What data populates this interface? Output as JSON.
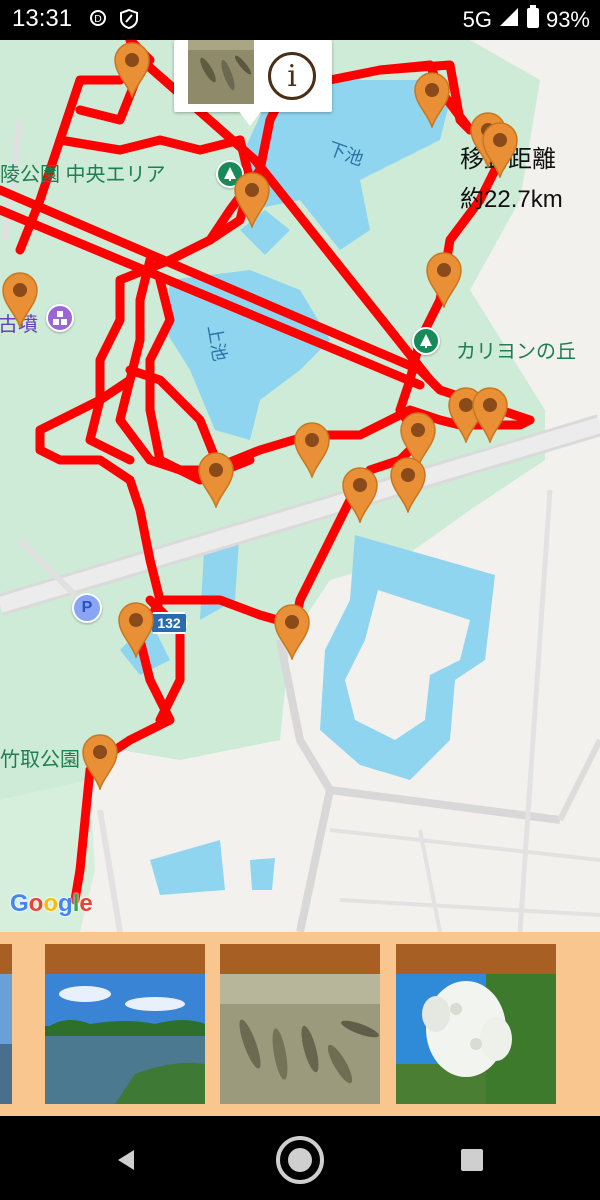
{
  "status": {
    "time": "13:31",
    "network": "5G",
    "battery": "93%",
    "icons": [
      "data-saver-icon",
      "shield-icon",
      "signal-icon",
      "battery-icon"
    ]
  },
  "map": {
    "labels": {
      "central_area": "陵公園 中央エリア",
      "lower_pond": "下池",
      "upper_pond": "上池",
      "kofun": "古墳",
      "carillon_hill": "カリヨンの丘",
      "taketori_park": "竹取公園",
      "route_number": "132",
      "parking": "P"
    },
    "distance": {
      "line1": "移動距離",
      "line2": "約22.7km"
    },
    "info_button": "i",
    "attribution": {
      "letters": [
        "G",
        "o",
        "o",
        "g",
        "l",
        "e"
      ],
      "colors": [
        "#4285F4",
        "#EA4335",
        "#FBBC05",
        "#4285F4",
        "#34A853",
        "#EA4335"
      ]
    },
    "colors": {
      "track": "#ff0000",
      "pin": "#e98f35",
      "pin_dot": "#8a4a1a",
      "park": "#cdebd7",
      "water": "#8fd5ef"
    }
  },
  "photo_strip": {
    "photos": [
      "lake-photo",
      "fish-photo",
      "wisteria-photo"
    ]
  },
  "nav": {
    "icons": [
      "back-icon",
      "home-icon",
      "recents-icon"
    ]
  }
}
